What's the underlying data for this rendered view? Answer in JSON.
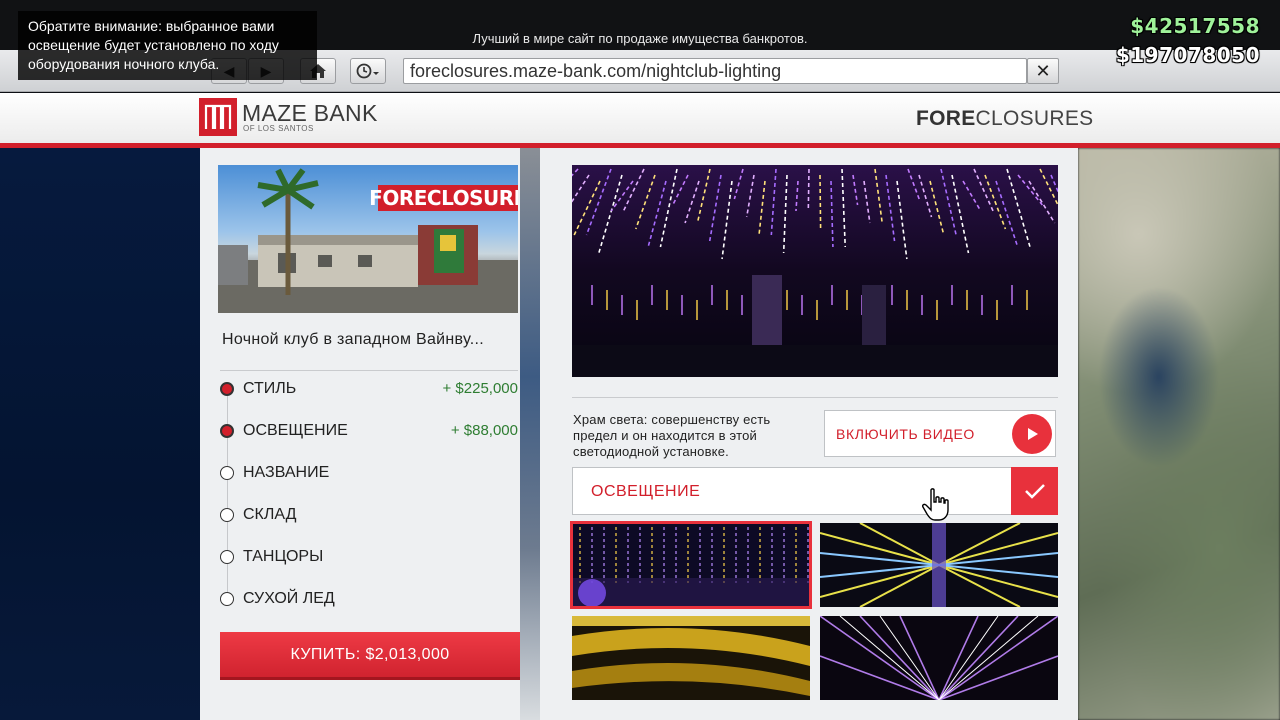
{
  "notice": "Обратите внимание: выбранное вами освещение будет установлено по ходу оборудования ночного клуба.",
  "tagline": "Лучший в мире сайт по продаже имущества банкротов.",
  "money": {
    "cash": "$42517558",
    "bank": "$197078050"
  },
  "browser": {
    "url": "foreclosures.maze-bank.com/nightclub-lighting",
    "close_label": "✕",
    "back_icon": "back-arrow-icon",
    "forward_icon": "forward-arrow-icon",
    "home_icon": "home-icon",
    "history_icon": "clock-icon"
  },
  "site": {
    "logo_title": "MAZE BANK",
    "logo_sub": "OF LOS SANTOS",
    "section_bold": "FORE",
    "section_rest": "CLOSURES"
  },
  "property": {
    "badge": "FORECLOSURE",
    "name": "Ночной клуб в западном Вайнву..."
  },
  "options": [
    {
      "label": "СТИЛЬ",
      "price": "+ $225,000",
      "selected": true
    },
    {
      "label": "ОСВЕЩЕНИЕ",
      "price": "+ $88,000",
      "selected": true
    },
    {
      "label": "НАЗВАНИЕ",
      "price": "",
      "selected": false
    },
    {
      "label": "СКЛАД",
      "price": "",
      "selected": false
    },
    {
      "label": "ТАНЦОРЫ",
      "price": "",
      "selected": false
    },
    {
      "label": "СУХОЙ ЛЕД",
      "price": "",
      "selected": false
    }
  ],
  "buy_label": "КУПИТЬ: $2,013,000",
  "detail": {
    "description": "Храм света: совершенству есть предел и он находится в этой светодиодной установке.",
    "video_label": "ВКЛЮЧИТЬ ВИДЕО",
    "selector_label": "ОСВЕЩЕНИЕ"
  },
  "colors": {
    "accent": "#d21f2b",
    "price_green": "#2e7d32",
    "cash_green": "#9ff29a"
  }
}
